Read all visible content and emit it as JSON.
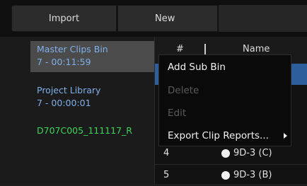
{
  "toolbar": {
    "import_label": "Import",
    "new_label": "New"
  },
  "bins": [
    {
      "name": "Master Clips Bin",
      "duration": "7 - 00:11:59"
    },
    {
      "name": "Project Library",
      "duration": "7 - 00:00:01"
    },
    {
      "name": "D707C005_111117_R"
    }
  ],
  "table": {
    "header_num": "#",
    "header_name": "Name",
    "rows": [
      {
        "num": "4",
        "name": "9D-3 (C)"
      },
      {
        "num": "5",
        "name": "9D-3 (B)"
      }
    ]
  },
  "context_menu": {
    "items": [
      {
        "label": "Add Sub Bin",
        "enabled": true
      },
      {
        "label": "Delete",
        "enabled": false
      },
      {
        "label": "Edit",
        "enabled": false
      },
      {
        "label": "Export Clip Reports...",
        "enabled": true,
        "has_submenu": true
      }
    ]
  },
  "icons": {
    "row_status": "circle-icon",
    "submenu": "chevron-right-icon"
  },
  "colors": {
    "selection": "#2f5f9a",
    "bin_text": "#7fb0e8",
    "clip_text": "#3ad65a"
  }
}
